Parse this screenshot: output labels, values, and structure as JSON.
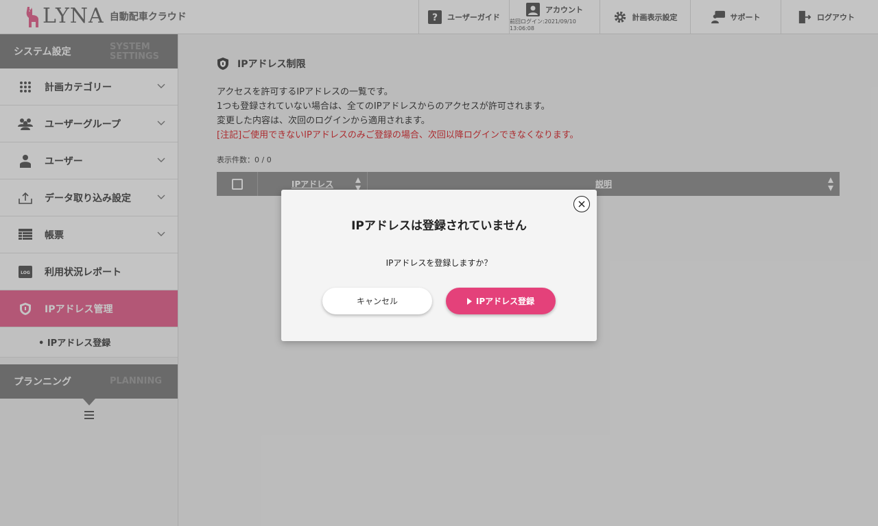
{
  "header": {
    "logo_text": "LYNA",
    "logo_sub": "自動配車クラウド",
    "nav": {
      "guide": "ユーザーガイド",
      "account": "アカウント",
      "last_login": "前回ログイン:2021/09/10 13:06:08",
      "plan_settings": "計画表示設定",
      "support": "サポート",
      "logout": "ログアウト"
    }
  },
  "sidebar": {
    "system_title": "システム設定",
    "system_en": "SYSTEM SETTINGS",
    "items": [
      {
        "label": "計画カテゴリー",
        "icon": "grid-icon"
      },
      {
        "label": "ユーザーグループ",
        "icon": "users-icon"
      },
      {
        "label": "ユーザー",
        "icon": "user-icon"
      },
      {
        "label": "データ取り込み設定",
        "icon": "upload-icon"
      },
      {
        "label": "帳票",
        "icon": "list-icon"
      },
      {
        "label": "利用状況レポート",
        "icon": "log-icon"
      },
      {
        "label": "IPアドレス管理",
        "icon": "shield-icon"
      }
    ],
    "sub_item": "• IPアドレス登録",
    "planning_title": "プランニング",
    "planning_en": "PLANNING"
  },
  "main": {
    "page_title": "IPアドレス制限",
    "desc_lines": [
      "アクセスを許可するIPアドレスの一覧です。",
      "1つも登録されていない場合は、全てのIPアドレスからのアクセスが許可されます。",
      "変更した内容は、次回のログインから適用されます。"
    ],
    "warning": "[注記]ご使用できないIPアドレスのみご登録の場合、次回以降ログインできなくなります。",
    "count": "表示件数：0 / 0",
    "table": {
      "col_ip": "IPアドレス",
      "col_desc": "説明"
    }
  },
  "modal": {
    "title": "IPアドレスは登録されていません",
    "message": "IPアドレスを登録しますか？",
    "cancel": "キャンセル",
    "submit": "IPアドレス登録"
  },
  "colors": {
    "accent": "#e4417a",
    "active_menu": "#e9729a",
    "section_header": "#8a8a8a",
    "warning": "#e0393e"
  }
}
